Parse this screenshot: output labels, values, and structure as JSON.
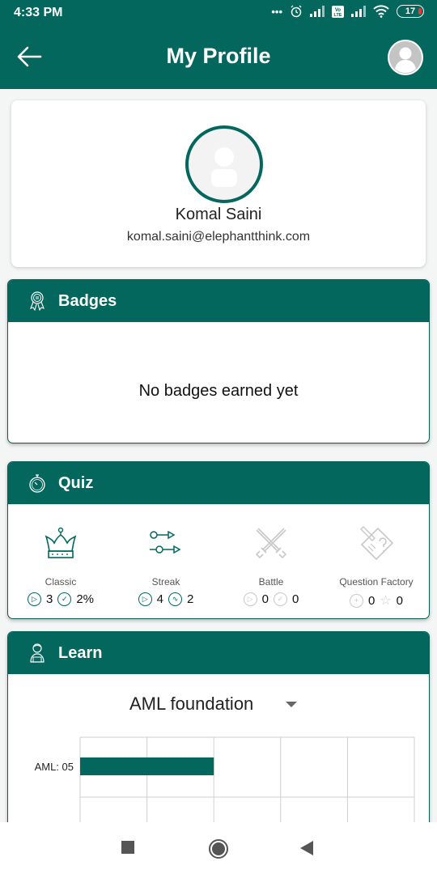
{
  "status_bar": {
    "time": "4:33 PM",
    "battery": "17",
    "icons": [
      "more-dots-icon",
      "alarm-icon",
      "signal-icon",
      "volte-icon",
      "signal-icon",
      "wifi-icon",
      "battery-icon"
    ],
    "volte": "Vo\nLTE"
  },
  "header": {
    "title": "My Profile",
    "back_icon": "arrow-left-icon",
    "avatar_icon": "user-avatar-icon"
  },
  "profile": {
    "name": "Komal Saini",
    "email": "komal.saini@elephantthink.com"
  },
  "badges": {
    "title": "Badges",
    "icon": "award-ribbon-icon",
    "empty_message": "No badges earned yet"
  },
  "quiz": {
    "title": "Quiz",
    "icon": "stopwatch-icon",
    "modes": [
      {
        "name": "Classic",
        "icon": "crown-icon",
        "active": true,
        "stat1_icon": "play-icon",
        "stat1": "3",
        "stat2_icon": "check-icon",
        "stat2": "2%"
      },
      {
        "name": "Streak",
        "icon": "streak-arrows-icon",
        "active": true,
        "stat1_icon": "play-icon",
        "stat1": "4",
        "stat2_icon": "wave-icon",
        "stat2": "2"
      },
      {
        "name": "Battle",
        "icon": "crossed-swords-icon",
        "active": false,
        "stat1_icon": "play-icon",
        "stat1": "0",
        "stat2_icon": "check-icon",
        "stat2": "0"
      },
      {
        "name": "Question Factory",
        "icon": "question-paper-icon",
        "active": false,
        "stat1_icon": "plus-icon",
        "stat1": "0",
        "stat2_icon": "star-icon",
        "stat2": "0"
      }
    ]
  },
  "learn": {
    "title": "Learn",
    "icon": "learner-icon",
    "selected_course": "AML foundation"
  },
  "chart_data": {
    "type": "bar",
    "orientation": "horizontal",
    "categories": [
      "AML: 05"
    ],
    "values": [
      2
    ],
    "xlim": [
      0,
      5
    ],
    "grid": true,
    "title": "",
    "xlabel": "",
    "ylabel": "",
    "bar_color": "#03675d"
  },
  "nav_bar": {
    "buttons": [
      "recents-button",
      "home-button",
      "back-button"
    ]
  },
  "colors": {
    "primary": "#03675d",
    "inactive": "#c8c8c8"
  }
}
